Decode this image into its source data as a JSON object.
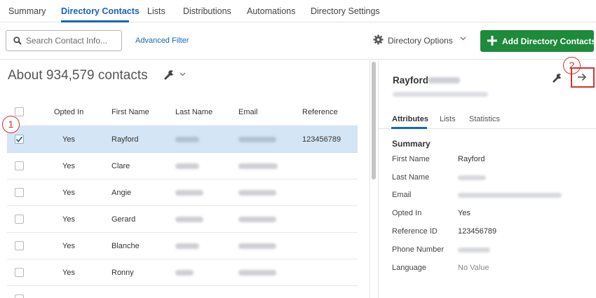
{
  "tabs": [
    "Summary",
    "Directory Contacts",
    "Lists",
    "Distributions",
    "Automations",
    "Directory Settings"
  ],
  "toolbar": {
    "search_placeholder": "Search Contact Info...",
    "advanced_filter": "Advanced Filter",
    "directory_options": "Directory Options",
    "add_button": "Add Directory Contacts"
  },
  "contacts_count": "About 934,579 contacts",
  "columns": [
    "Opted In",
    "First Name",
    "Last Name",
    "Email",
    "Reference"
  ],
  "rows": [
    {
      "checked": true,
      "opted_in": "Yes",
      "first_name": "Rayford",
      "reference": "123456789"
    },
    {
      "checked": false,
      "opted_in": "Yes",
      "first_name": "Clare",
      "reference": ""
    },
    {
      "checked": false,
      "opted_in": "Yes",
      "first_name": "Angie",
      "reference": ""
    },
    {
      "checked": false,
      "opted_in": "Yes",
      "first_name": "Gerard",
      "reference": ""
    },
    {
      "checked": false,
      "opted_in": "Yes",
      "first_name": "Blanche",
      "reference": ""
    },
    {
      "checked": false,
      "opted_in": "Yes",
      "first_name": "Ronny",
      "reference": ""
    }
  ],
  "panel": {
    "name": "Rayford",
    "tabs": [
      "Attributes",
      "Lists",
      "Statistics"
    ],
    "summary_heading": "Summary",
    "attributes": [
      {
        "label": "First Name",
        "value": "Rayford"
      },
      {
        "label": "Last Name",
        "value": null
      },
      {
        "label": "Email",
        "value": null
      },
      {
        "label": "Opted In",
        "value": "Yes"
      },
      {
        "label": "Reference ID",
        "value": "123456789"
      },
      {
        "label": "Phone Number",
        "value": null
      },
      {
        "label": "Language",
        "value": "No Value",
        "muted": true
      }
    ]
  },
  "annotations": [
    "1",
    "2"
  ],
  "colors": {
    "accent": "#1a64b8",
    "add_button": "#1e8a3c",
    "selected_row": "#d4e5f5",
    "annotation": "#d0342c"
  }
}
